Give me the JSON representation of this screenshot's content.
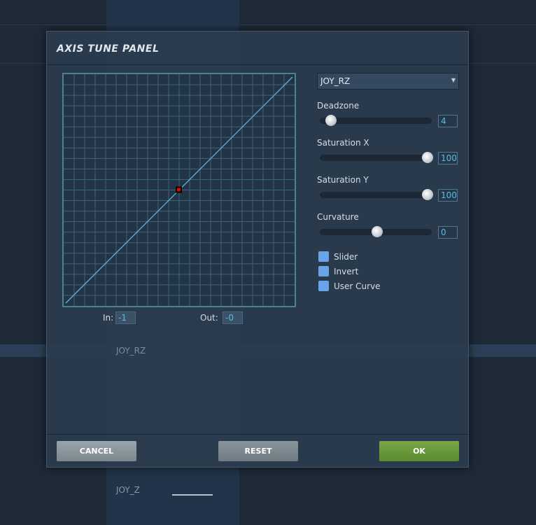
{
  "background": {
    "rows": [
      "JOY_RZ",
      "JOY_Z"
    ]
  },
  "dialog": {
    "title": "AXIS TUNE PANEL",
    "axis_select": "JOY_RZ",
    "graph": {
      "in_label": "In:",
      "in_value": "-1",
      "out_label": "Out:",
      "out_value": "-0",
      "grid_divisions": 22,
      "curve": "linear"
    },
    "sliders": [
      {
        "label": "Deadzone",
        "value": "4",
        "fraction": 0.04
      },
      {
        "label": "Saturation X",
        "value": "100",
        "fraction": 1.0
      },
      {
        "label": "Saturation Y",
        "value": "100",
        "fraction": 1.0
      },
      {
        "label": "Curvature",
        "value": "0",
        "fraction": 0.5
      }
    ],
    "checkboxes": [
      {
        "label": "Slider"
      },
      {
        "label": "Invert"
      },
      {
        "label": "User Curve"
      }
    ],
    "buttons": {
      "cancel": "CANCEL",
      "reset": "RESET",
      "ok": "OK"
    }
  }
}
